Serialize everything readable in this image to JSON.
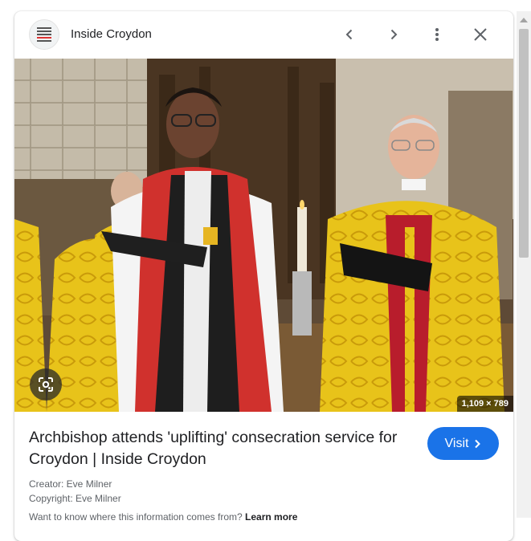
{
  "header": {
    "site_name": "Inside Croydon",
    "favicon_icon": "newspaper-favicon-icon",
    "prev_icon": "chevron-left-icon",
    "next_icon": "chevron-right-icon",
    "more_icon": "more-vert-icon",
    "close_icon": "close-icon"
  },
  "image": {
    "dimensions": "1,109 × 789",
    "lens_icon": "google-lens-icon"
  },
  "result": {
    "title": "Archbishop attends 'uplifting' consecration service for Croydon | Inside Croydon",
    "visit_label": "Visit",
    "creator": "Creator: Eve Milner",
    "copyright": "Copyright: Eve Milner",
    "info_text": "Want to know where this information comes from?",
    "learn_more": "Learn more"
  },
  "colors": {
    "visit_button": "#1a73e8",
    "text_primary": "#202124",
    "text_secondary": "#5f6368"
  }
}
